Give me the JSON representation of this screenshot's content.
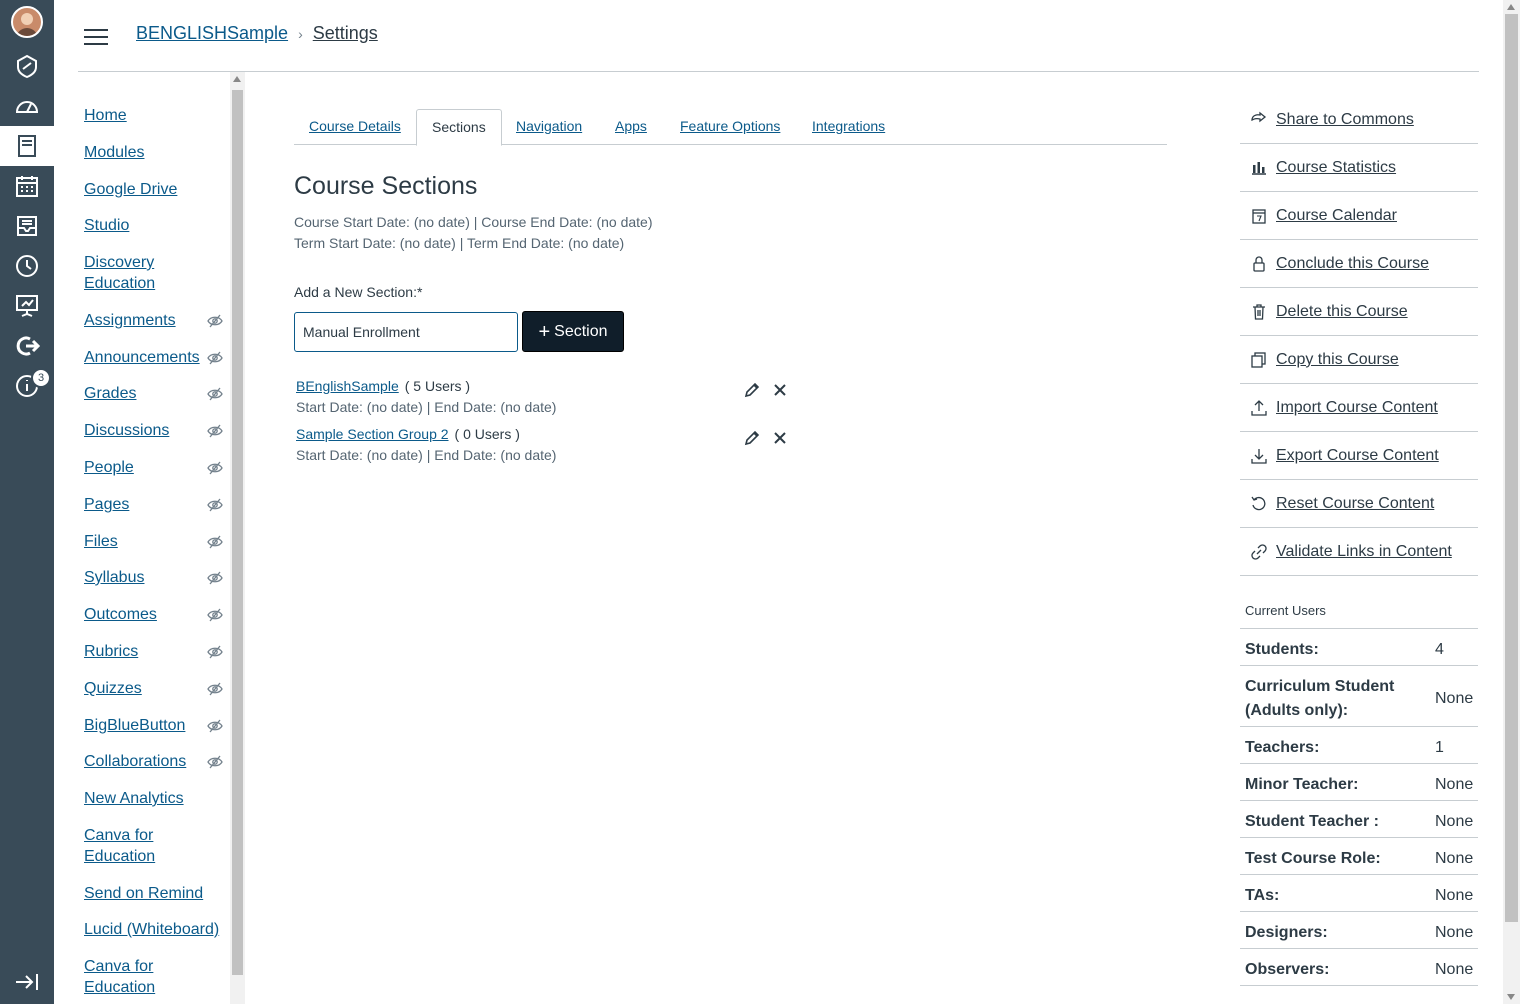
{
  "breadcrumb": {
    "course": "BENGLISHSample",
    "current": "Settings"
  },
  "course_nav": {
    "items": [
      {
        "label": "Home",
        "hidden": false
      },
      {
        "label": "Modules",
        "hidden": false
      },
      {
        "label": "Google Drive",
        "hidden": false
      },
      {
        "label": "Studio",
        "hidden": false
      },
      {
        "label": "Discovery Education",
        "hidden": false
      },
      {
        "label": "Assignments",
        "hidden": true
      },
      {
        "label": "Announcements",
        "hidden": true
      },
      {
        "label": "Grades",
        "hidden": true
      },
      {
        "label": "Discussions",
        "hidden": true
      },
      {
        "label": "People",
        "hidden": true
      },
      {
        "label": "Pages",
        "hidden": true
      },
      {
        "label": "Files",
        "hidden": true
      },
      {
        "label": "Syllabus",
        "hidden": true
      },
      {
        "label": "Outcomes",
        "hidden": true
      },
      {
        "label": "Rubrics",
        "hidden": true
      },
      {
        "label": "Quizzes",
        "hidden": true
      },
      {
        "label": "BigBlueButton",
        "hidden": true
      },
      {
        "label": "Collaborations",
        "hidden": true
      },
      {
        "label": "New Analytics",
        "hidden": false
      },
      {
        "label": "Canva for Education",
        "hidden": false
      },
      {
        "label": "Send on Remind",
        "hidden": false
      },
      {
        "label": "Lucid (Whiteboard)",
        "hidden": false
      },
      {
        "label": "Canva for Education",
        "hidden": false
      }
    ]
  },
  "global_nav": {
    "help_badge": "3"
  },
  "tabs": [
    {
      "label": "Course Details",
      "active": false
    },
    {
      "label": "Sections",
      "active": true
    },
    {
      "label": "Navigation",
      "active": false
    },
    {
      "label": "Apps",
      "active": false
    },
    {
      "label": "Feature Options",
      "active": false
    },
    {
      "label": "Integrations",
      "active": false
    }
  ],
  "main": {
    "title": "Course Sections",
    "course_dates": "Course Start Date: (no date) | Course End Date: (no date)",
    "term_dates": "Term Start Date: (no date) | Term End Date: (no date)",
    "add_label": "Add a New Section:*",
    "input_value": "Manual Enrollment",
    "add_button": "Section",
    "sections": [
      {
        "name": "BEnglishSample",
        "users": "( 5 Users )",
        "dates": "Start Date: (no date) | End Date: (no date)"
      },
      {
        "name": "Sample Section Group 2",
        "users": "( 0 Users )",
        "dates": "Start Date: (no date) | End Date: (no date)"
      }
    ]
  },
  "sidebar": {
    "links": [
      {
        "label": "Share to Commons",
        "icon": "share-icon"
      },
      {
        "label": "Course Statistics",
        "icon": "bar-chart-icon"
      },
      {
        "label": "Course Calendar",
        "icon": "calendar-icon"
      },
      {
        "label": "Conclude this Course",
        "icon": "lock-icon"
      },
      {
        "label": "Delete this Course",
        "icon": "trash-icon"
      },
      {
        "label": "Copy this Course",
        "icon": "copy-icon"
      },
      {
        "label": "Import Course Content",
        "icon": "upload-icon"
      },
      {
        "label": "Export Course Content",
        "icon": "download-icon"
      },
      {
        "label": "Reset Course Content",
        "icon": "reset-icon"
      },
      {
        "label": "Validate Links in Content",
        "icon": "link-icon"
      }
    ],
    "current_users_title": "Current Users",
    "users": [
      {
        "role": "Students:",
        "count": "4"
      },
      {
        "role": "Curriculum Student (Adults only):",
        "count": "None"
      },
      {
        "role": "Teachers:",
        "count": "1"
      },
      {
        "role": "Minor Teacher:",
        "count": "None"
      },
      {
        "role": "Student Teacher :",
        "count": "None"
      },
      {
        "role": "Test Course Role:",
        "count": "None"
      },
      {
        "role": "TAs:",
        "count": "None"
      },
      {
        "role": "Designers:",
        "count": "None"
      },
      {
        "role": "Observers:",
        "count": "None"
      }
    ]
  }
}
